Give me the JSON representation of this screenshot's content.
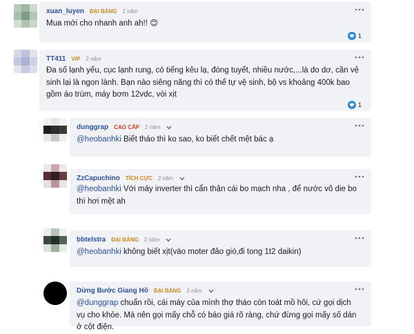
{
  "comments": [
    {
      "username": "xuan_luyen",
      "rank": "ĐẠI BÀNG",
      "time": "2 năm",
      "text": "Mua mới cho nhanh anh ah!! 😊",
      "reactions": "1"
    },
    {
      "username": "TT411",
      "rank": "VIP",
      "time": "2 năm",
      "text": "Đa số lạnh yếu, cục lạnh rung, có tiếng kêu lạ, đóng tuyết, nhiều nước,...là do dơ, cần vệ sinh lại là ngon lành. Bạn nào siêng năng thì có thể tự vệ sinh, bộ vs khoảng 400k bao gồm áo trùm, máy bơm 12vdc, vòi xịt",
      "reactions": "1"
    },
    {
      "username": "dunggrap",
      "rank": "CAO CẤP",
      "time": "2 năm",
      "mention": "@heobanhki",
      "text": " Biết tháo thì ko sao, ko biết chết mệt bác ạ"
    },
    {
      "username": "ZzCapuchino",
      "rank": "TÍCH CỰC",
      "time": "2 năm",
      "mention": "@heobanhki",
      "text": " Với máy inverter thì cẩn thận cái bo mạch nha , để nước vô die bo thì hơi mệt ah"
    },
    {
      "username": "bbtelstra",
      "rank": "ĐẠI BÀNG",
      "time": "2 năm",
      "mention": "@heobanhki",
      "text": " không biết xịt(vào moter đảo gió,đi tong 1t2 daikin)"
    },
    {
      "username": "Dừng Bước Giang Hồ",
      "rank": "ĐẠI BÀNG",
      "time": "2 năm",
      "mention": "@dunggrap",
      "text": " chuẩn rồi, cái máy của mình thợ tháo còn toát mồ hôi, cứ gọi dịch vụ cho khỏe. Mà nên gọi mấy chỗ có báo giá rõ ràng, chứ đừng gọi mấy số dán ở cột điện."
    }
  ],
  "icons": {
    "menu": "more-dots-icon",
    "reaction": "heart-icon",
    "expand": "chevron-down-icon"
  },
  "colors": {
    "username": "#2b52a6",
    "rank_gold": "#d18a1f",
    "rank_red": "#e0402a",
    "card_bg": "#f1f2f6",
    "reaction_heart": "#2a8bdc"
  }
}
